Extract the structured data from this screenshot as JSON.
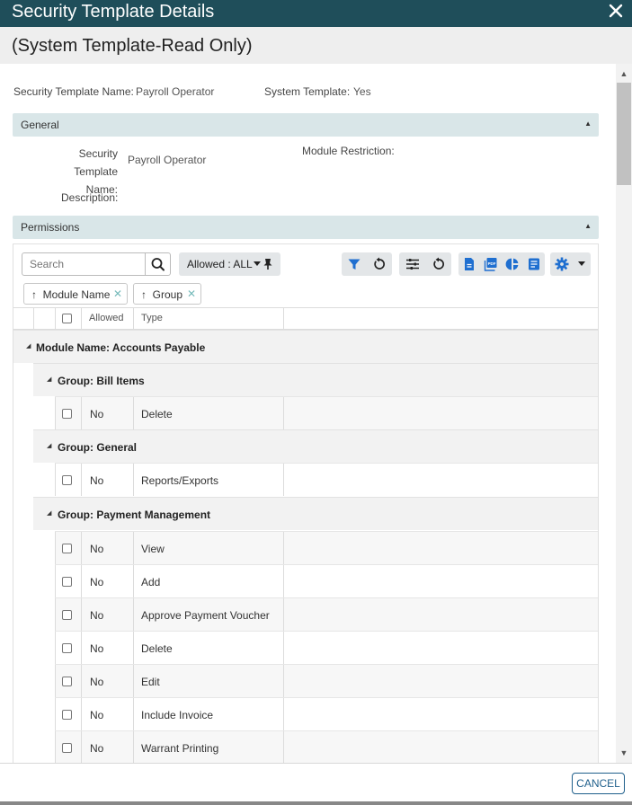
{
  "dialog": {
    "title": "Security Template Details",
    "subtitle": "(System Template-Read Only)"
  },
  "summary": {
    "name_label": "Security Template Name:",
    "name_value": "Payroll Operator",
    "system_label": "System Template:",
    "system_value": "Yes"
  },
  "general": {
    "title": "General",
    "name_label_line1": "Security Template",
    "name_label_line2": "Name:",
    "name_value": "Payroll Operator",
    "module_restriction_label": "Module Restriction:",
    "module_restriction_value": "",
    "description_label": "Description:",
    "description_value": ""
  },
  "permissions": {
    "title": "Permissions",
    "search_placeholder": "Search",
    "allowed_filter": "Allowed : ALL",
    "group_chips": [
      "Module Name",
      "Group"
    ],
    "columns": [
      "Allowed",
      "Type"
    ],
    "module_group": "Module Name: Accounts Payable",
    "groups": [
      {
        "label": "Group: Bill Items",
        "rows": [
          {
            "allowed": "No",
            "type": "Delete"
          }
        ]
      },
      {
        "label": "Group: General",
        "rows": [
          {
            "allowed": "No",
            "type": "Reports/Exports"
          }
        ]
      },
      {
        "label": "Group: Payment Management",
        "rows": [
          {
            "allowed": "No",
            "type": "View"
          },
          {
            "allowed": "No",
            "type": "Add"
          },
          {
            "allowed": "No",
            "type": "Approve Payment Voucher"
          },
          {
            "allowed": "No",
            "type": "Delete"
          },
          {
            "allowed": "No",
            "type": "Edit"
          },
          {
            "allowed": "No",
            "type": "Include Invoice"
          },
          {
            "allowed": "No",
            "type": "Warrant Printing"
          }
        ]
      }
    ]
  },
  "footer": {
    "cancel_label": "CANCEL"
  },
  "colors": {
    "title_bar": "#1f4e5a",
    "section_bar": "#d9e6e8",
    "accent": "#1f5f8b",
    "icon_blue": "#1f6fd0"
  },
  "icons": [
    "close-icon",
    "search-icon",
    "pin-icon",
    "filter-icon",
    "reset-icon",
    "columns-icon",
    "excel-icon",
    "pdf-icon",
    "chart-icon",
    "report-icon",
    "gear-icon"
  ]
}
